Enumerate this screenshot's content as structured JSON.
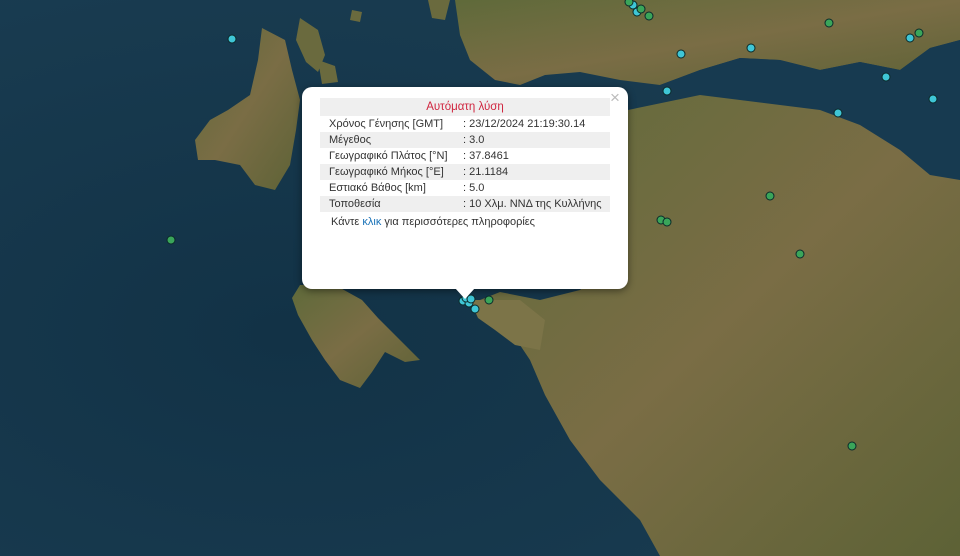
{
  "popup": {
    "title": "Αυτόματη λύση",
    "close_label": "×",
    "rows": [
      {
        "label": "Χρόνος Γένησης [GMT]",
        "value": ": 23/12/2024 21:19:30.14"
      },
      {
        "label": "Μέγεθος",
        "value": ": 3.0"
      },
      {
        "label": "Γεωγραφικό Πλάτος [°N]",
        "value": ": 37.8461"
      },
      {
        "label": "Γεωγραφικό Μήκος [°E]",
        "value": ": 21.1184"
      },
      {
        "label": "Εστιακό Βάθος [km]",
        "value": ": 5.0"
      },
      {
        "label": "Τοποθεσία",
        "value": ": 10 Χλμ. ΝΝΔ της Κυλλήνης"
      }
    ],
    "more_prefix": "Κάντε ",
    "more_link": "κλικ",
    "more_suffix": " για περισσότερες πληροφορίες"
  },
  "colors": {
    "sea": "#15354a",
    "land": "#6b6a3c",
    "marker_recent": "#3fc6d6",
    "marker_older": "#3aa55a",
    "popup_title": "#d0253f",
    "link": "#1a73b8"
  },
  "markers": [
    {
      "color": "cyan"
    },
    {
      "color": "cyan"
    },
    {
      "color": "cyan"
    },
    {
      "color": "cyan"
    },
    {
      "color": "cyan"
    },
    {
      "color": "cyan"
    },
    {
      "color": "cyan"
    },
    {
      "color": "cyan"
    },
    {
      "color": "cyan"
    },
    {
      "color": "cyan"
    },
    {
      "color": "cyan"
    },
    {
      "color": "cyan"
    },
    {
      "color": "cyan"
    },
    {
      "color": "cyan"
    },
    {
      "color": "cyan"
    },
    {
      "color": "green"
    },
    {
      "color": "green"
    },
    {
      "color": "green"
    },
    {
      "color": "green"
    },
    {
      "color": "green"
    },
    {
      "color": "green"
    },
    {
      "color": "green"
    },
    {
      "color": "green"
    },
    {
      "color": "green"
    },
    {
      "color": "green"
    },
    {
      "color": "green"
    },
    {
      "color": "green"
    }
  ]
}
